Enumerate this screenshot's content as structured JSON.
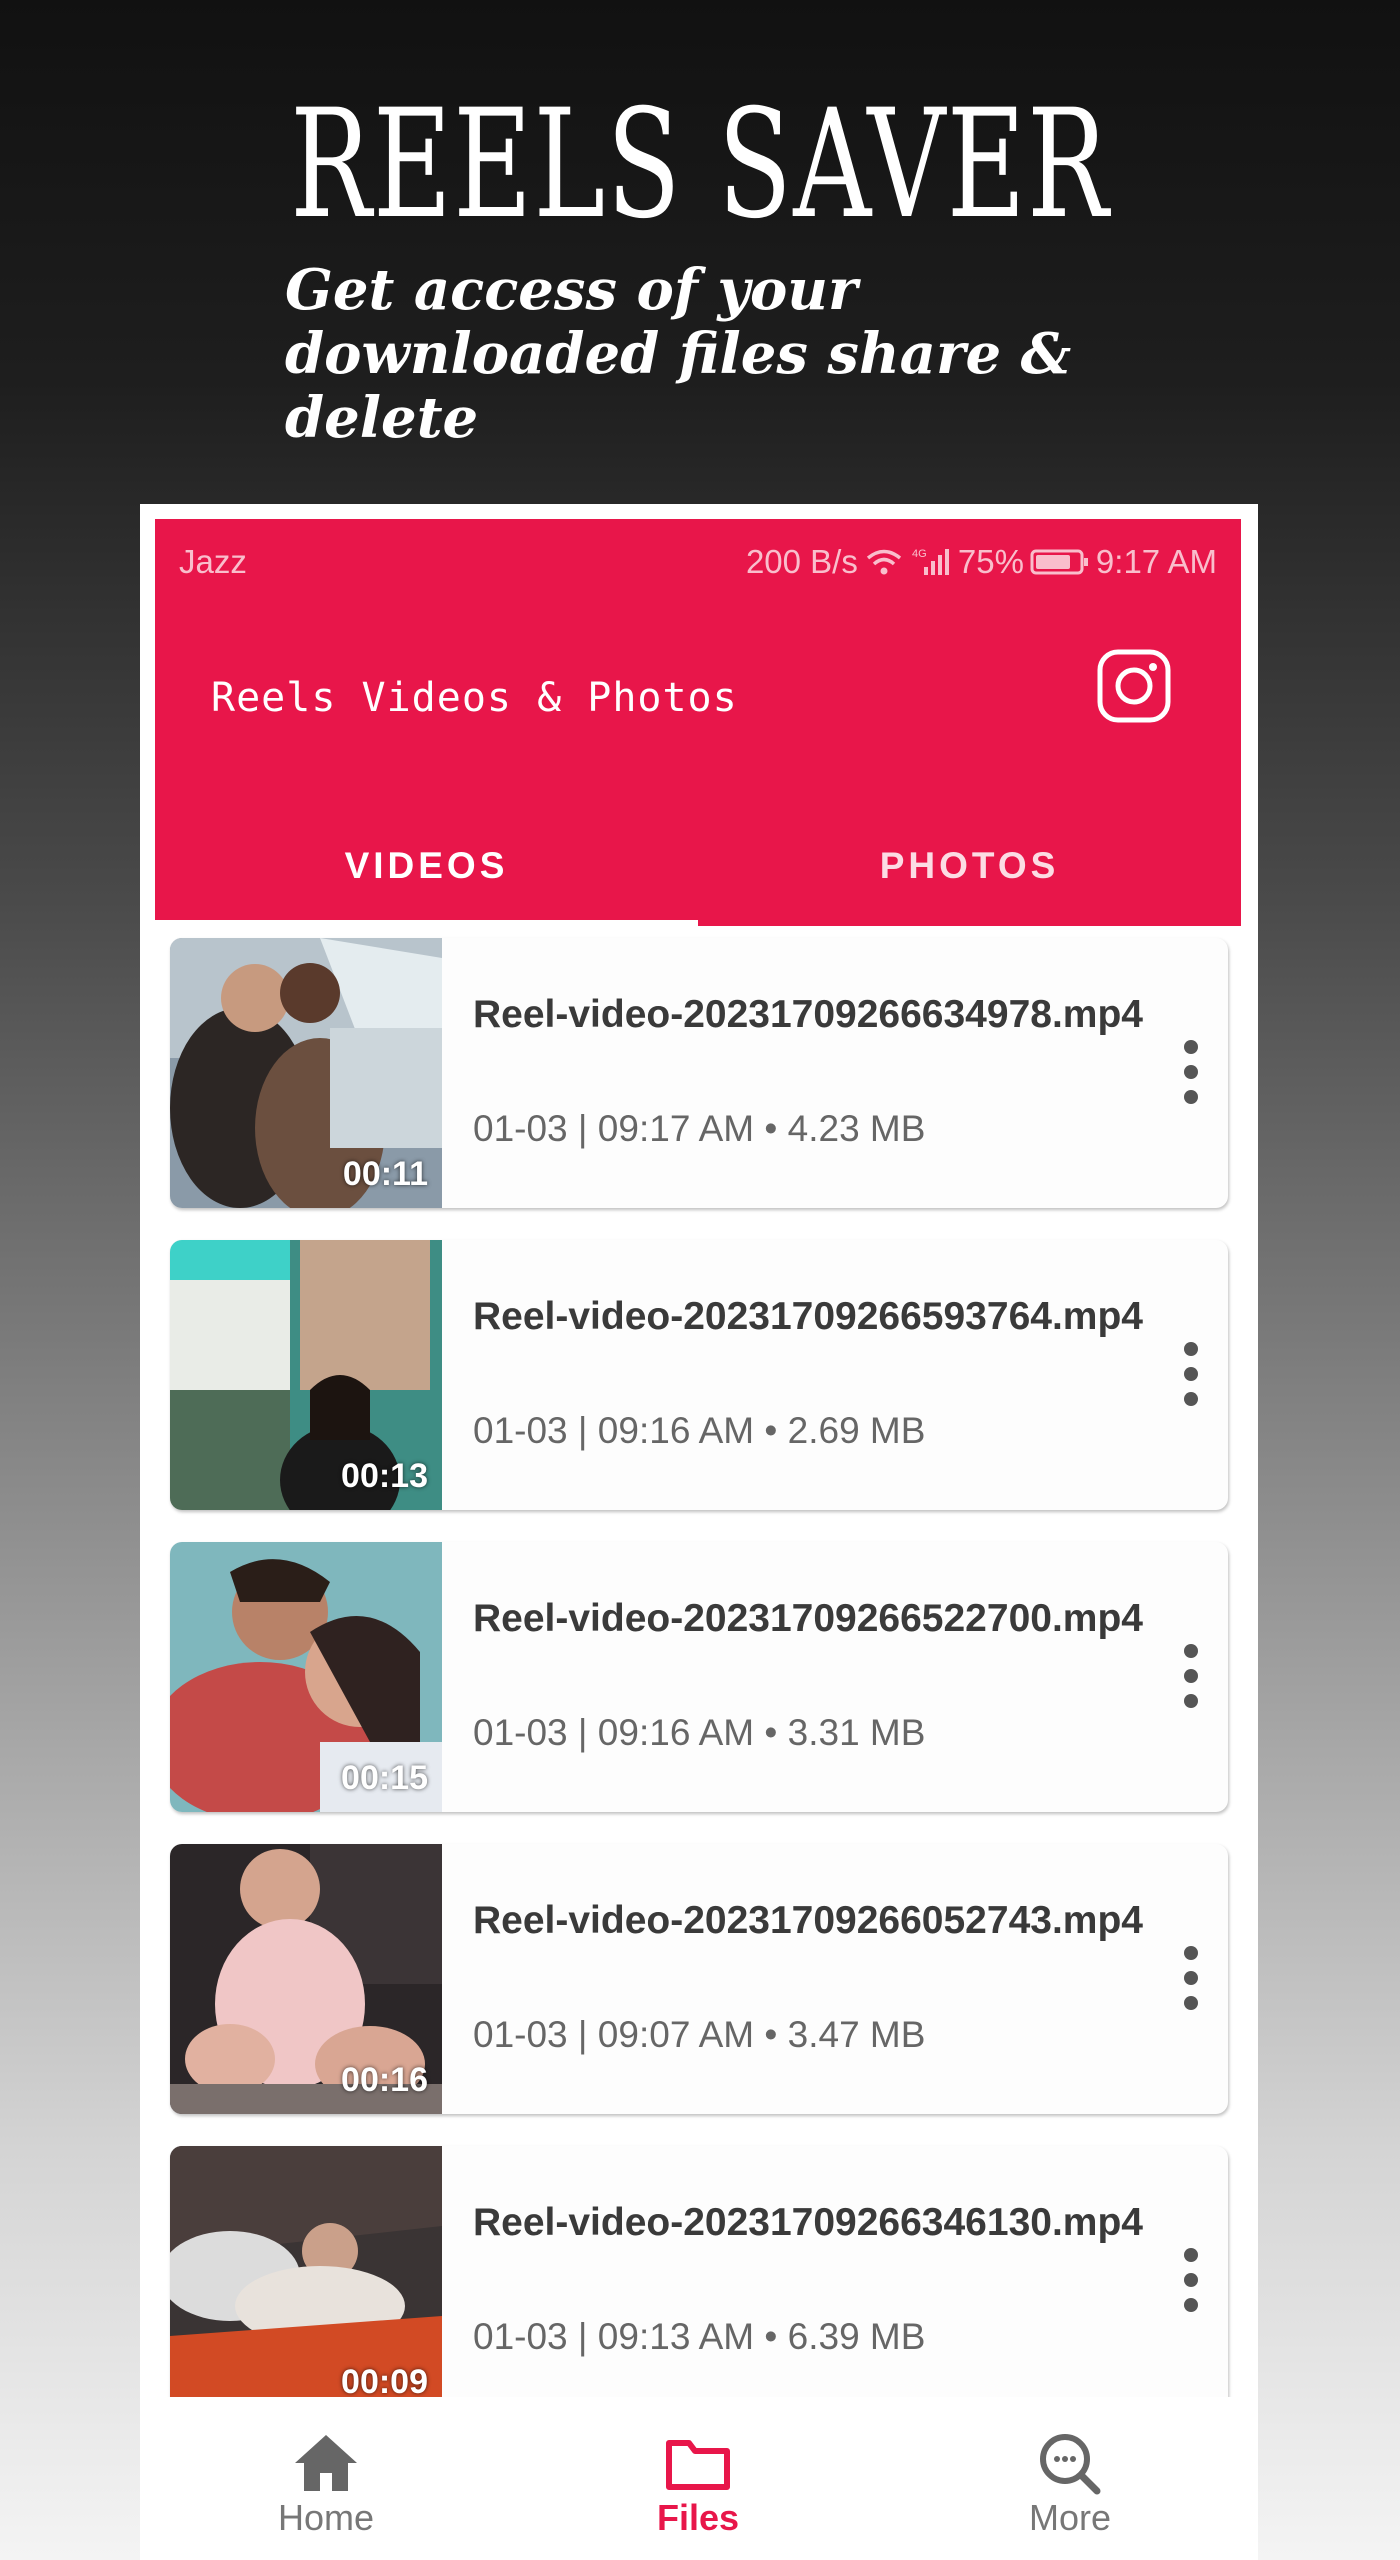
{
  "promo": {
    "title": "REELS SAVER",
    "subtitle": "Get access of your downloaded files share & delete"
  },
  "status_bar": {
    "carrier": "Jazz",
    "speed": "200 B/s",
    "battery": "75%",
    "time": "9:17 AM"
  },
  "app_bar": {
    "title": "Reels Videos & Photos",
    "instagram_icon": "instagram-icon"
  },
  "tabs": [
    {
      "label": "VIDEOS",
      "active": true
    },
    {
      "label": "PHOTOS",
      "active": false
    }
  ],
  "videos": [
    {
      "filename": "Reel-video-2023170926663497​8.mp4",
      "date_time": "01-03 | 09:17 AM",
      "size": "4.23 MB",
      "meta": "01-03 | 09:17 AM • 4.23 MB",
      "duration": "00:11"
    },
    {
      "filename": "Reel-video-20231709266593764.mp4",
      "date_time": "01-03 | 09:16 AM",
      "size": "2.69 MB",
      "meta": "01-03 | 09:16 AM • 2.69 MB",
      "duration": "00:13"
    },
    {
      "filename": "Reel-video-20231709266522700.mp4",
      "date_time": "01-03 | 09:16 AM",
      "size": "3.31 MB",
      "meta": "01-03 | 09:16 AM • 3.31 MB",
      "duration": "00:15"
    },
    {
      "filename": "Reel-video-20231709266052743.mp4",
      "date_time": "01-03 | 09:07 AM",
      "size": "3.47 MB",
      "meta": "01-03 | 09:07 AM • 3.47 MB",
      "duration": "00:16"
    },
    {
      "filename": "Reel-video-20231709266346130.mp4",
      "date_time": "01-03 | 09:13 AM",
      "size": "6.39 MB",
      "meta": "01-03 | 09:13 AM • 6.39 MB",
      "duration": "00:09"
    }
  ],
  "bottom_nav": [
    {
      "label": "Home",
      "icon": "home-icon",
      "active": false
    },
    {
      "label": "Files",
      "icon": "folder-icon",
      "active": true
    },
    {
      "label": "More",
      "icon": "search-icon",
      "active": false
    }
  ],
  "colors": {
    "accent": "#e8164a",
    "text_dark": "#3a3a3a",
    "text_meta": "#666666"
  }
}
